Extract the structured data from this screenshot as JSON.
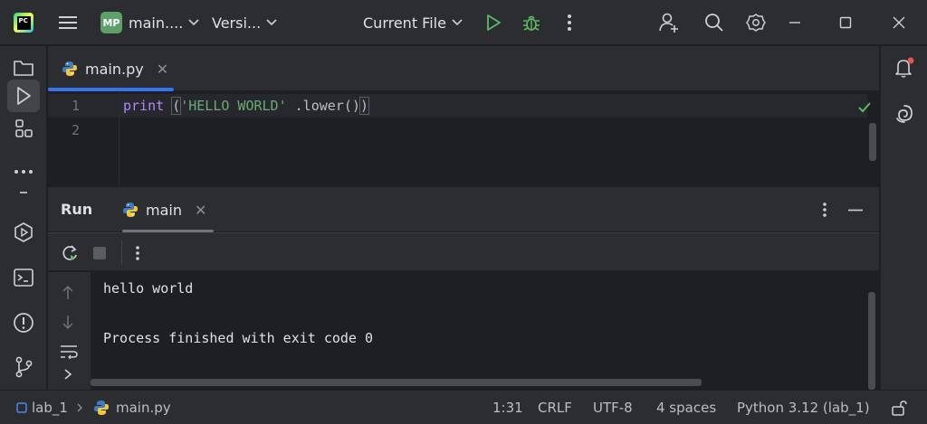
{
  "titlebar": {
    "project_badge": "MP",
    "project_name": "main....",
    "vcs_label": "Versi...",
    "run_config": "Current File"
  },
  "editor": {
    "tab_label": "main.py",
    "lines": [
      {
        "number": "1"
      },
      {
        "number": "2"
      }
    ],
    "code": {
      "fn": "print",
      "open_paren": "(",
      "string": "'HELLO WORLD'",
      "method": " .lower()",
      "close_paren": ")"
    }
  },
  "run_panel": {
    "title": "Run",
    "tab_label": "main",
    "output_line_1": "hello world",
    "output_line_2": "Process finished with exit code 0"
  },
  "statusbar": {
    "project": "lab_1",
    "file": "main.py",
    "position": "1:31",
    "line_sep": "CRLF",
    "encoding": "UTF-8",
    "indent": "4 spaces",
    "interpreter": "Python 3.12 (lab_1)"
  },
  "colors": {
    "accent": "#3574f0",
    "run_green": "#5fb865",
    "project_badge": "#5fa06a",
    "notification_dot": "#e55353"
  }
}
